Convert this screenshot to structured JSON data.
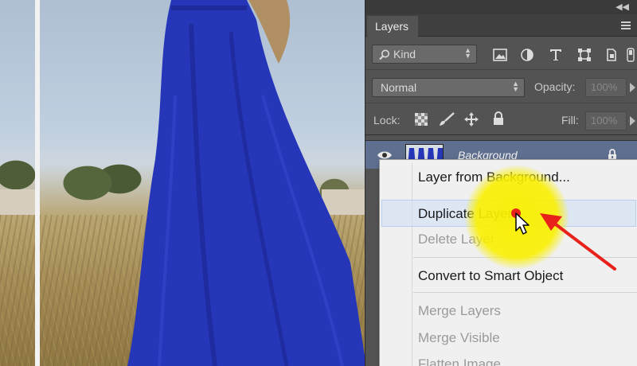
{
  "panel": {
    "tab_label": "Layers",
    "filter": {
      "kind_label": "Kind"
    },
    "blend": {
      "mode": "Normal",
      "opacity_label": "Opacity:",
      "opacity_value": "100%"
    },
    "lock": {
      "label": "Lock:",
      "fill_label": "Fill:",
      "fill_value": "100%"
    },
    "layer": {
      "name": "Background"
    }
  },
  "context_menu": {
    "items": [
      {
        "label": "Layer from Background...",
        "enabled": true
      },
      {
        "label": "Duplicate Layer",
        "enabled": true,
        "hovered": true
      },
      {
        "label": "Delete Layer",
        "enabled": false
      },
      {
        "label": "Convert to Smart Object",
        "enabled": true
      },
      {
        "label": "Merge Layers",
        "enabled": false
      },
      {
        "label": "Merge Visible",
        "enabled": false
      },
      {
        "label": "Flatten Image",
        "enabled": false
      }
    ]
  },
  "colors": {
    "dress": "#2636b8",
    "highlight": "#f7ef00",
    "annotation": "#e8221b",
    "selected_layer": "#5f6f8f"
  }
}
